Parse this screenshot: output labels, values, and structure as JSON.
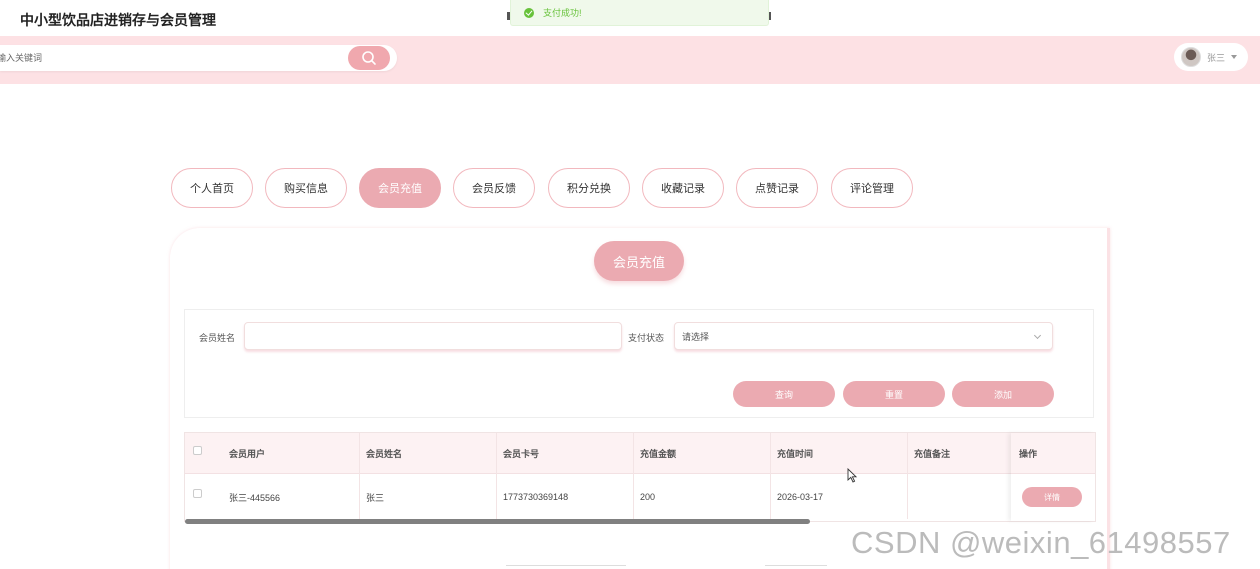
{
  "app": {
    "title": "中小型饮品店进销存与会员管理"
  },
  "toast": {
    "message": "支付成功!",
    "type": "success",
    "color": "#67c23a"
  },
  "search": {
    "placeholder": "输入关键词",
    "icon": "search-icon"
  },
  "user": {
    "name": "张三",
    "icon": "avatar"
  },
  "nav": {
    "tabs": [
      "个人首页",
      "购买信息",
      "会员充值",
      "会员反馈",
      "积分兑换",
      "收藏记录",
      "点赞记录",
      "评论管理"
    ],
    "active": "会员充值"
  },
  "panel": {
    "title": "会员充值"
  },
  "filters": {
    "name_label": "会员姓名",
    "name_value": "",
    "status_label": "支付状态",
    "status_value": "请选择",
    "buttons": {
      "query": "查询",
      "reset": "重置",
      "add": "添加"
    }
  },
  "table": {
    "columns": [
      "会员用户",
      "会员姓名",
      "会员卡号",
      "充值金额",
      "充值时间",
      "充值备注",
      "操作"
    ],
    "rows": [
      {
        "user": "张三-445566",
        "name": "张三",
        "card": "1773730369148",
        "amount": "200",
        "time": "2026-03-17",
        "note": "",
        "action": "详情"
      }
    ]
  },
  "watermark": "CSDN @weixin_61498557",
  "colors": {
    "accent": "#ebaab1",
    "header_bg": "#fde1e4",
    "success": "#67c23a"
  }
}
